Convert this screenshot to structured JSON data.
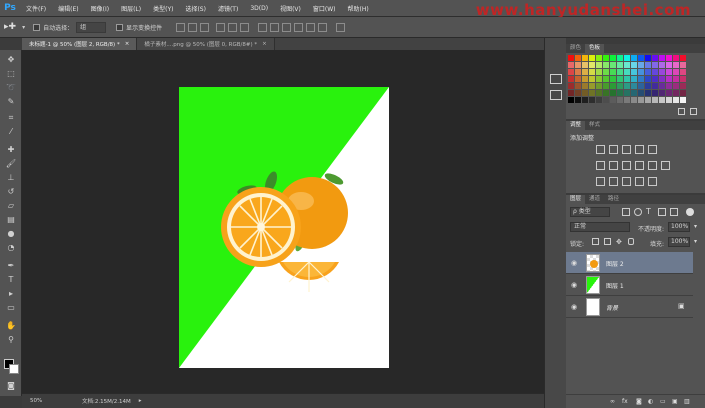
{
  "app": {
    "logo": "Ps"
  },
  "menu": [
    "文件(F)",
    "编辑(E)",
    "图像(I)",
    "图层(L)",
    "类型(Y)",
    "选择(S)",
    "滤镜(T)",
    "3D(D)",
    "视图(V)",
    "窗口(W)",
    "帮助(H)"
  ],
  "watermark": "www.hanyudanshei.com",
  "options": {
    "auto_select_label": "自动选择：",
    "auto_select_value": "组",
    "show_transform_label": "显示变换控件"
  },
  "tabs": [
    {
      "label": "未标题-1 @ 50% (图层 2, RGB/8) *",
      "close": "×"
    },
    {
      "label": "橘子素材....png @ 50% (图层 0, RGB/8#) *",
      "close": "×"
    }
  ],
  "status": {
    "zoom": "50%",
    "doc": "文档:2.15M/2.14M"
  },
  "panels": {
    "color_tabs": [
      "颜色",
      "色板"
    ],
    "adjust_tabs": [
      "调整",
      "样式"
    ],
    "adjust_title": "添加调整",
    "layer_tabs": [
      "图层",
      "通道",
      "路径"
    ],
    "filter_label": "ρ 类型",
    "blend_mode": "正常",
    "opacity_label": "不透明度:",
    "opacity_value": "100%",
    "lock_label": "锁定:",
    "fill_label": "填充:",
    "fill_value": "100%",
    "layers": [
      {
        "name": "图层 2",
        "selected": true
      },
      {
        "name": "图层 1",
        "selected": false
      },
      {
        "name": "背景",
        "selected": false
      }
    ]
  },
  "colors": {
    "accent_green": "#29f20d",
    "selection": "#6d7a8f",
    "ps_blue": "#31a8ff"
  }
}
